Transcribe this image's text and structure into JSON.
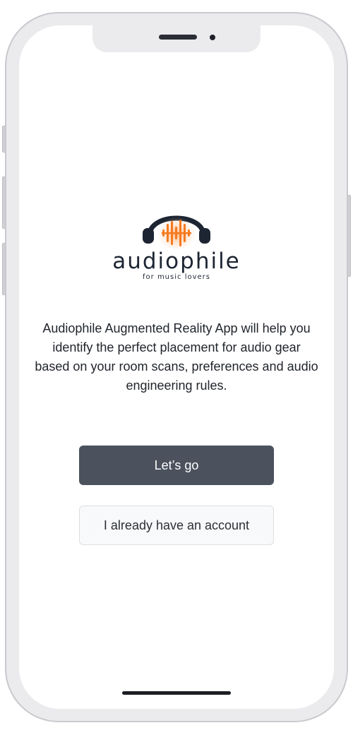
{
  "app": {
    "logo": {
      "wordmark": "audiophile",
      "tagline": "for music lovers",
      "accent_color": "#f57a1f",
      "dark_color": "#1d2533"
    },
    "description": "Audiophile Augmented Reality App will help you identify the perfect placement for audio gear based on your room scans, preferences and audio engineering rules.",
    "buttons": {
      "primary_label": "Let’s go",
      "secondary_label": "I already have an account"
    },
    "colors": {
      "primary_button": "#4b525e",
      "secondary_button": "#f8f9fa",
      "text": "#1f2329"
    }
  }
}
